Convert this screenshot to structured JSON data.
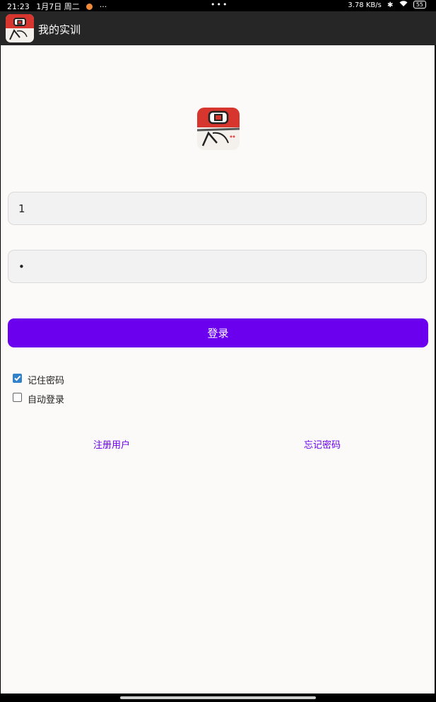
{
  "status_bar": {
    "time": "21:23",
    "date": "1月7日 周二",
    "more_dots": "···",
    "center_dots": "•••",
    "net_speed": "3.78 KB/s",
    "battery": "55"
  },
  "app_bar": {
    "title": "我的实训",
    "icon": "app-logo-icon"
  },
  "login_form": {
    "username_value": "1",
    "password_value": "•",
    "login_label": "登录",
    "remember_label": "记住密码",
    "remember_checked": true,
    "auto_login_label": "自动登录",
    "auto_login_checked": false
  },
  "links": {
    "register": "注册用户",
    "forgot": "忘记密码"
  },
  "colors": {
    "accent": "#6a00ee",
    "app_bar": "#262626",
    "background": "#fbfaf9",
    "checkbox": "#3182c8"
  }
}
